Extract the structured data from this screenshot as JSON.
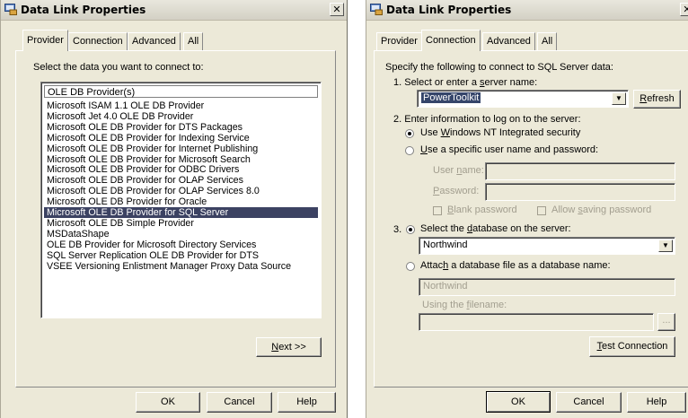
{
  "left_dialog": {
    "title": "Data Link Properties",
    "close_glyph": "✕",
    "tabs": [
      "Provider",
      "Connection",
      "Advanced",
      "All"
    ],
    "prompt": "Select the data you want to connect to:",
    "list_header": "OLE DB Provider(s)",
    "providers": [
      "Microsoft ISAM 1.1 OLE DB Provider",
      "Microsoft Jet 4.0 OLE DB Provider",
      "Microsoft OLE DB Provider for DTS Packages",
      "Microsoft OLE DB Provider for Indexing Service",
      "Microsoft OLE DB Provider for Internet Publishing",
      "Microsoft OLE DB Provider for Microsoft Search",
      "Microsoft OLE DB Provider for ODBC Drivers",
      "Microsoft OLE DB Provider for OLAP Services",
      "Microsoft OLE DB Provider for OLAP Services 8.0",
      "Microsoft OLE DB Provider for Oracle",
      "Microsoft OLE DB Provider for SQL Server",
      "Microsoft OLE DB Simple Provider",
      "MSDataShape",
      "OLE DB Provider for Microsoft Directory Services",
      "SQL Server Replication OLE DB Provider for DTS",
      "VSEE Versioning Enlistment Manager Proxy Data Source"
    ],
    "selected_provider": "Microsoft OLE DB Provider for SQL Server",
    "next_key": "N",
    "next_rest": "ext >>",
    "ok_label": "OK",
    "cancel_label": "Cancel",
    "help_label": "Help"
  },
  "right_dialog": {
    "title": "Data Link Properties",
    "close_glyph": "✕",
    "tabs": [
      "Provider",
      "Connection",
      "Advanced",
      "All"
    ],
    "intro": "Specify the following to connect to SQL Server data:",
    "step1_pre": "1. Select or enter a ",
    "step1_key": "s",
    "step1_post": "erver name:",
    "server_name": "PowerToolkit",
    "refresh_key": "R",
    "refresh_rest": "efresh",
    "step2": "2. Enter information to log on to the server:",
    "nt_pre": "Use ",
    "nt_key": "W",
    "nt_post": "indows NT Integrated security",
    "specific_key": "U",
    "specific_post": "se a specific user name and password:",
    "user_pre": "User ",
    "user_key": "n",
    "user_post": "ame:",
    "password_key": "P",
    "password_post": "assword:",
    "blank_key": "B",
    "blank_post": "lank password",
    "allow_pre": "Allow ",
    "allow_key": "s",
    "allow_post": "aving password",
    "step3_num": "3.",
    "select_db_pre": "Select the ",
    "select_db_key": "d",
    "select_db_post": "atabase on the server:",
    "database_value": "Northwind",
    "attach_pre": "Attac",
    "attach_key": "h",
    "attach_post": " a database file as a database name:",
    "attach_value": "Northwind",
    "filename_pre": "Using the ",
    "filename_key": "f",
    "filename_post": "ilename:",
    "browse_label": "...",
    "test_key": "T",
    "test_rest": "est Connection",
    "ok_label": "OK",
    "cancel_label": "Cancel",
    "help_label": "Help"
  }
}
